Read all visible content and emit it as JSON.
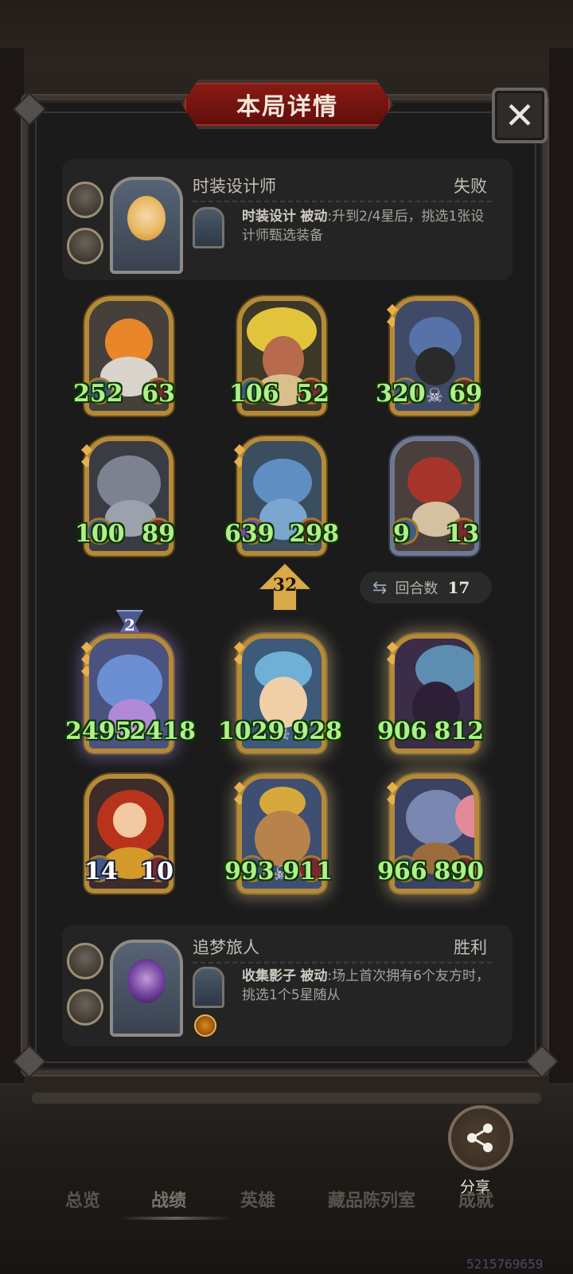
{
  "dialog": {
    "title": "本局详情",
    "close_label": "✕"
  },
  "player_top": {
    "name": "时装设计师",
    "result": "失败",
    "skill_name": "时装设计",
    "skill_type": "被动",
    "skill_desc": ":升到2/4星后，挑选1张设计师甄选装备"
  },
  "enemy_units": [
    {
      "attack": "252",
      "health": "63"
    },
    {
      "attack": "106",
      "health": "52"
    },
    {
      "attack": "320",
      "health": "69"
    },
    {
      "attack": "100",
      "health": "89"
    },
    {
      "attack": "639",
      "health": "298"
    },
    {
      "attack": "9",
      "health": "13"
    }
  ],
  "tavern_tier": "32",
  "round": {
    "label": "回合数",
    "value": "17"
  },
  "ally_units": [
    {
      "attack": "2495",
      "health": "2418",
      "badge": "2"
    },
    {
      "attack": "1029",
      "health": "928"
    },
    {
      "attack": "906",
      "health": "812"
    },
    {
      "attack": "14",
      "health": "10"
    },
    {
      "attack": "993",
      "health": "911"
    },
    {
      "attack": "966",
      "health": "890"
    }
  ],
  "player_bottom": {
    "name": "追梦旅人",
    "result": "胜利",
    "skill_name": "收集影子",
    "skill_type": "被动",
    "skill_desc": ":场上首次拥有6个友方时，挑选1个5星随从"
  },
  "share_label": "分享",
  "nav": [
    "总览",
    "战绩",
    "英雄",
    "藏品陈列室",
    "成就"
  ],
  "watermark": "5215769659",
  "colors": {
    "stat_green": "#aef08a",
    "card_gold": "#b48a3a",
    "banner_red": "#8a1a14"
  }
}
